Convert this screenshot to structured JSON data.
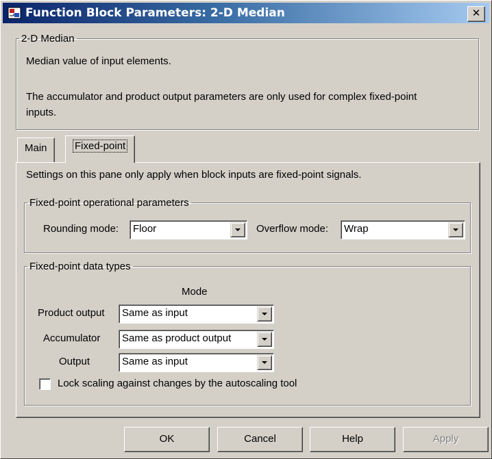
{
  "window": {
    "title": "Function Block Parameters: 2-D Median",
    "close_label": "✕"
  },
  "description": {
    "group_title": "2-D Median",
    "line1": "Median value of input elements.",
    "line2": "The accumulator and product output parameters are only used for complex fixed-point",
    "line3": "inputs."
  },
  "tabs": [
    {
      "label": "Main",
      "active": false
    },
    {
      "label": "Fixed-point",
      "active": true
    }
  ],
  "panel": {
    "info_text": "Settings on this pane only apply when block inputs are fixed-point signals.",
    "operational": {
      "group_title": "Fixed-point operational parameters",
      "rounding_label": "Rounding mode:",
      "rounding_value": "Floor",
      "overflow_label": "Overflow mode:",
      "overflow_value": "Wrap"
    },
    "datatypes": {
      "group_title": "Fixed-point data types",
      "mode_header": "Mode",
      "rows": [
        {
          "label": "Product output",
          "value": "Same as input"
        },
        {
          "label": "Accumulator",
          "value": "Same as product output"
        },
        {
          "label": "Output",
          "value": "Same as input"
        }
      ],
      "lock_label": "Lock scaling against changes by the autoscaling tool",
      "lock_checked": false
    }
  },
  "buttons": {
    "ok": "OK",
    "cancel": "Cancel",
    "help": "Help",
    "apply": "Apply"
  },
  "colors": {
    "titlebar_start": "#0a246a",
    "titlebar_end": "#a6caf0",
    "face": "#d4d0c8"
  },
  "icons": {
    "title_icon": "simulink-block-icon",
    "close_icon": "close-icon"
  }
}
